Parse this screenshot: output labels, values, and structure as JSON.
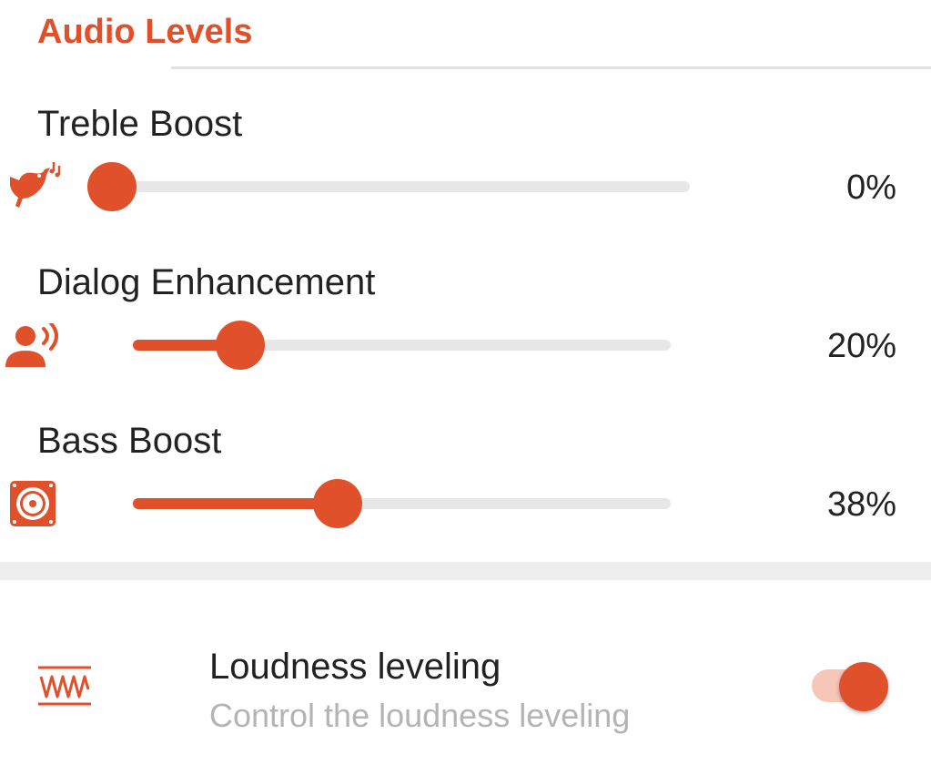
{
  "colors": {
    "accent": "#e0502a",
    "accent_light": "#f6c6b8",
    "track": "#e7e7e7",
    "text": "#222222",
    "subtext": "#b4b4b4"
  },
  "audio_levels": {
    "title": "Audio Levels",
    "sliders": [
      {
        "label": "Treble Boost",
        "value_text": "0%",
        "value": 0,
        "icon": "bird-music-icon"
      },
      {
        "label": "Dialog Enhancement",
        "value_text": "20%",
        "value": 20,
        "icon": "speaking-person-icon"
      },
      {
        "label": "Bass Boost",
        "value_text": "38%",
        "value": 38,
        "icon": "speaker-icon"
      }
    ]
  },
  "loudness": {
    "title": "Loudness leveling",
    "subtitle": "Control the loudness leveling",
    "enabled": true,
    "icon": "waveform-icon"
  }
}
